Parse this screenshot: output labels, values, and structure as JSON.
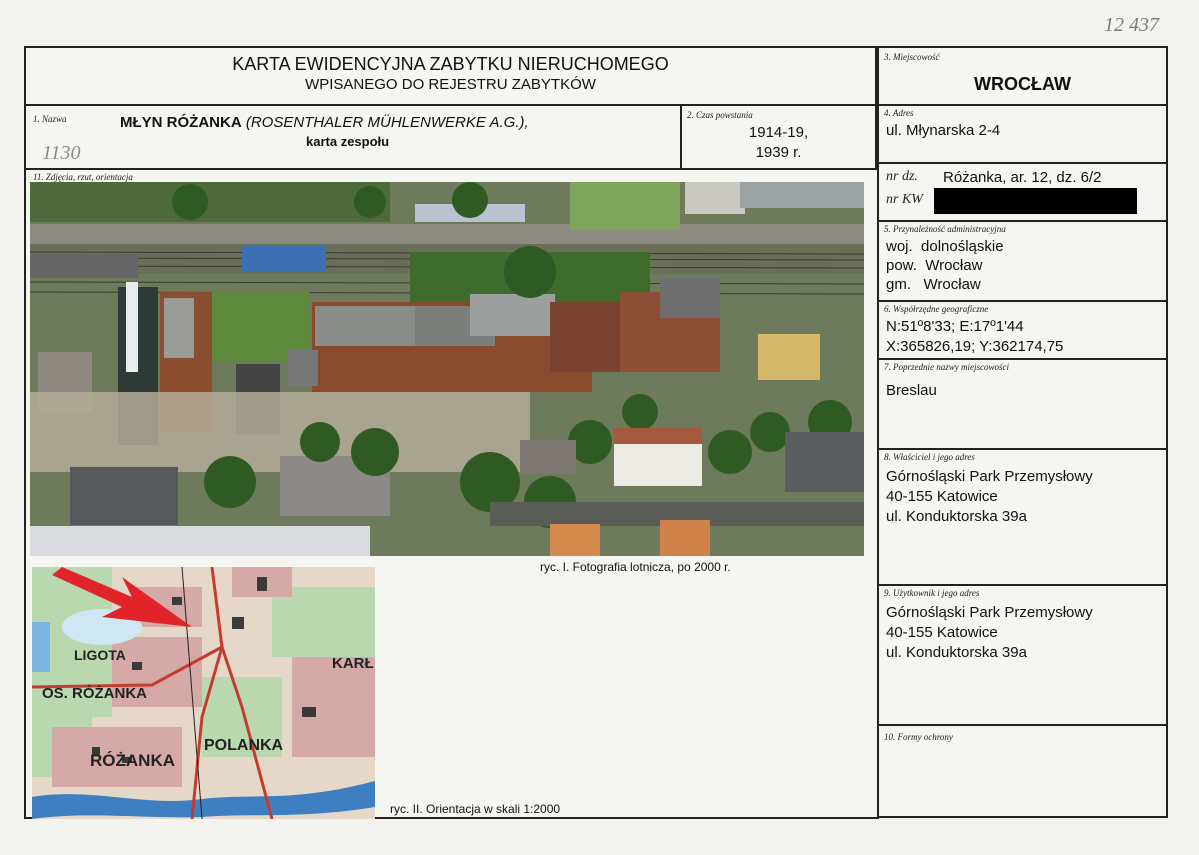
{
  "header": {
    "title_line1": "KARTA EWIDENCYJNA ZABYTKU NIERUCHOMEGO",
    "title_line2": "WPISANEGO DO REJESTRU ZABYTKÓW",
    "corner_number": "12 437"
  },
  "nazwa": {
    "label": "1. Nazwa",
    "name_bold": "MŁYN RÓŻANKA",
    "name_italic": "(ROSENTHALER MÜHLENWERKE A.G.),",
    "subtitle": "karta zespołu",
    "hand_note": "1130"
  },
  "czas": {
    "label": "2. Czas powstania",
    "line1": "1914-19,",
    "line2": "1939 r."
  },
  "miejscowosc": {
    "label": "3. Miejscowość",
    "value": "WROCŁAW"
  },
  "adres": {
    "label": "4. Adres",
    "value": "ul. Młynarska 2-4",
    "nr_dz_label": "nr dz.",
    "nr_dz_value": "Różanka, ar. 12, dz. 6/2",
    "nr_kw_label": "nr KW"
  },
  "przynaleznosc": {
    "label": "5. Przynależność administracyjna",
    "woj": "woj.  dolnośląskie",
    "pow": "pow.  Wrocław",
    "gm": "gm.   Wrocław"
  },
  "wspolrzedne": {
    "label": "6. Współrzędne geograficzne",
    "line1": "N:51º8'33; E:17º1'44",
    "line2": "X:365826,19; Y:362174,75"
  },
  "poprzednie": {
    "label": "7. Poprzednie nazwy miejscowości",
    "value": "Breslau"
  },
  "wlasciciel": {
    "label": "8. Właściciel i jego adres",
    "line1": "Górnośląski Park Przemysłowy",
    "line2": "40-155 Katowice",
    "line3": "ul. Konduktorska 39a"
  },
  "uzytkownik": {
    "label": "9. Użytkownik i jego adres",
    "line1": "Górnośląski Park Przemysłowy",
    "line2": "40-155 Katowice",
    "line3": "ul. Konduktorska 39a"
  },
  "formy": {
    "label": "10. Formy ochrony"
  },
  "zdjecia": {
    "label": "11. Zdjęcia, rzut, orientacja",
    "caption1": "ryc. I. Fotografia lotnicza, po 2000 r.",
    "caption2": "ryc. II. Orientacja w skali 1:2000"
  },
  "map_labels": {
    "ligota": "LIGOTA",
    "os_rozanka": "OS. RÓŻANKA",
    "rozanka": "RÓŻANKA",
    "polanka": "POLANKA",
    "karl": "KARŁ"
  },
  "colors": {
    "border": "#222222",
    "paper": "#f5f5f2",
    "map_red": "#e0242a",
    "river": "#3d7fc1"
  }
}
